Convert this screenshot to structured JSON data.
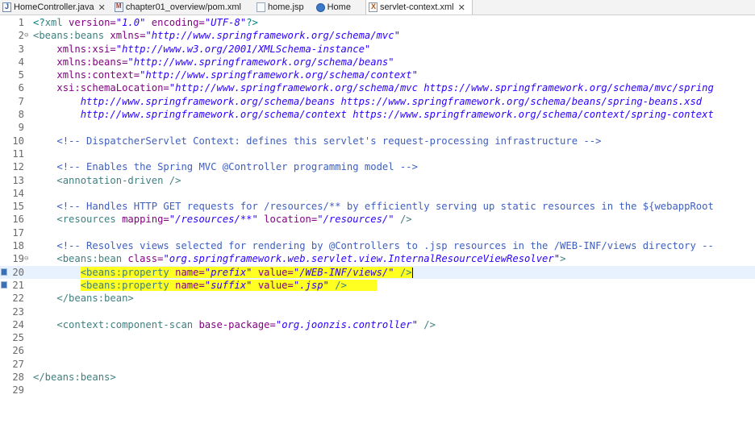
{
  "tabs": [
    {
      "icon": "java-file-icon",
      "label": "HomeController.java",
      "close": "✕"
    },
    {
      "icon": "maven-pom-icon",
      "label": "chapter01_overview/pom.xml",
      "close": ""
    },
    {
      "icon": "jsp-file-icon",
      "label": "home.jsp",
      "close": ""
    },
    {
      "icon": "globe-icon",
      "label": "Home",
      "close": ""
    },
    {
      "icon": "xml-file-icon",
      "label": "servlet-context.xml",
      "close": "✕"
    }
  ],
  "line_numbers": [
    "1",
    "2",
    "3",
    "4",
    "5",
    "6",
    "7",
    "8",
    "9",
    "10",
    "11",
    "12",
    "13",
    "14",
    "15",
    "16",
    "17",
    "18",
    "19",
    "20",
    "21",
    "22",
    "23",
    "24",
    "25",
    "26",
    "27",
    "28",
    "29"
  ],
  "fold_marks": {
    "l2": "⊖",
    "l19": "⊖"
  },
  "code": {
    "l1": {
      "a": "<?",
      "b": "xml",
      "c": " version=",
      "d": "\"1.0\"",
      "e": " encoding=",
      "f": "\"UTF-8\"",
      "g": "?>"
    },
    "l2": {
      "a": "<beans:beans",
      "b": " xmlns=",
      "c": "\"http://www.springframework.org/schema/mvc\""
    },
    "l3": {
      "a": "xmlns:xsi=",
      "b": "\"http://www.w3.org/2001/XMLSchema-instance\""
    },
    "l4": {
      "a": "xmlns:beans=",
      "b": "\"http://www.springframework.org/schema/beans\""
    },
    "l5": {
      "a": "xmlns:context=",
      "b": "\"http://www.springframework.org/schema/context\""
    },
    "l6": {
      "a": "xsi:schemaLocation=",
      "b": "\"http://www.springframework.org/schema/mvc https://www.springframework.org/schema/mvc/spring"
    },
    "l7": {
      "a": "http://www.springframework.org/schema/beans https://www.springframework.org/schema/beans/spring-beans.xsd"
    },
    "l8": {
      "a": "http://www.springframework.org/schema/context https://www.springframework.org/schema/context/spring-context"
    },
    "l10": {
      "a": "<!-- DispatcherServlet Context: defines this servlet's request-processing infrastructure -->"
    },
    "l12": {
      "a": "<!-- Enables the Spring MVC @Controller programming model -->"
    },
    "l13": {
      "a": "<annotation-driven />"
    },
    "l15": {
      "a": "<!-- Handles HTTP GET requests for /resources/** by efficiently serving up static resources in the ${webappRoot"
    },
    "l16": {
      "a": "<resources",
      "b": " mapping=",
      "c": "\"/resources/**\"",
      "d": " location=",
      "e": "\"/resources/\"",
      "f": " />"
    },
    "l18": {
      "a": "<!-- Resolves views selected for rendering by @Controllers to .jsp resources in the /WEB-INF/views directory --"
    },
    "l19": {
      "a": "<beans:bean",
      "b": " class=",
      "c": "\"org.springframework.web.servlet.view.InternalResourceViewResolver\"",
      "d": ">"
    },
    "l20": {
      "a": "<beans:property",
      "b": " name=",
      "c": "\"prefix\"",
      "d": " value=",
      "e": "\"/WEB-INF/views/\"",
      "f": " />"
    },
    "l21": {
      "a": "<beans:property",
      "b": " name=",
      "c": "\"suffix\"",
      "d": " value=",
      "e": "\".jsp\"",
      "f": " />"
    },
    "l22": {
      "a": "</beans:bean>"
    },
    "l24": {
      "a": "<context:component-scan",
      "b": " base-package=",
      "c": "\"org.joonzis.controller\"",
      "d": " />"
    },
    "l28": {
      "a": "</beans:beans>"
    }
  },
  "colors": {
    "tag": "#3f7f7f",
    "attribute": "#7f007f",
    "string": "#2a00ff",
    "comment": "#3f5fbf",
    "highlight": "#ffff22",
    "current_line": "#e8f2fe"
  }
}
